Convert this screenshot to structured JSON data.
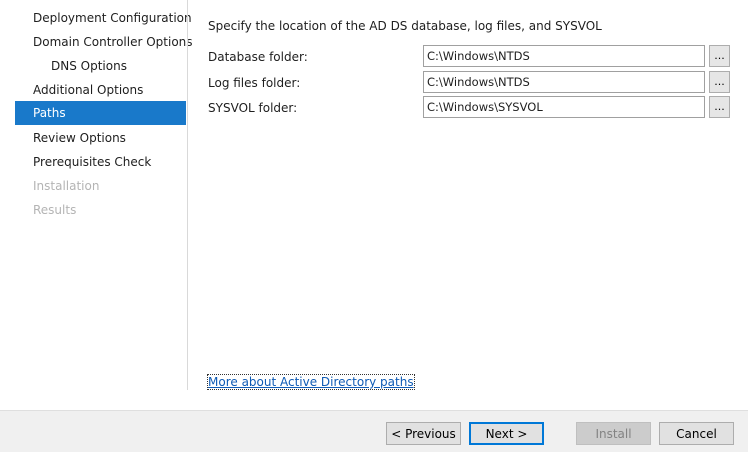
{
  "nav": {
    "items": [
      {
        "label": "Deployment Configuration",
        "state": "normal"
      },
      {
        "label": "Domain Controller Options",
        "state": "normal"
      },
      {
        "label": "DNS Options",
        "state": "normal",
        "indent": true
      },
      {
        "label": "Additional Options",
        "state": "normal"
      },
      {
        "label": "Paths",
        "state": "active"
      },
      {
        "label": "Review Options",
        "state": "normal"
      },
      {
        "label": "Prerequisites Check",
        "state": "normal"
      },
      {
        "label": "Installation",
        "state": "disabled"
      },
      {
        "label": "Results",
        "state": "disabled"
      }
    ]
  },
  "main": {
    "heading": "Specify the location of the AD DS database, log files, and SYSVOL",
    "fields": [
      {
        "label": "Database folder:",
        "value": "C:\\Windows\\NTDS",
        "browse_label": "..."
      },
      {
        "label": "Log files folder:",
        "value": "C:\\Windows\\NTDS",
        "browse_label": "..."
      },
      {
        "label": "SYSVOL folder:",
        "value": "C:\\Windows\\SYSVOL",
        "browse_label": "..."
      }
    ],
    "more_link": "More about Active Directory paths"
  },
  "footer": {
    "previous_label": "< Previous",
    "next_label": "Next >",
    "install_label": "Install",
    "cancel_label": "Cancel"
  },
  "colors": {
    "active_nav_bg": "#1979ca",
    "link": "#0f5bb5",
    "disabled_text": "#b4b4b4",
    "footer_bg": "#f0f0f0"
  }
}
